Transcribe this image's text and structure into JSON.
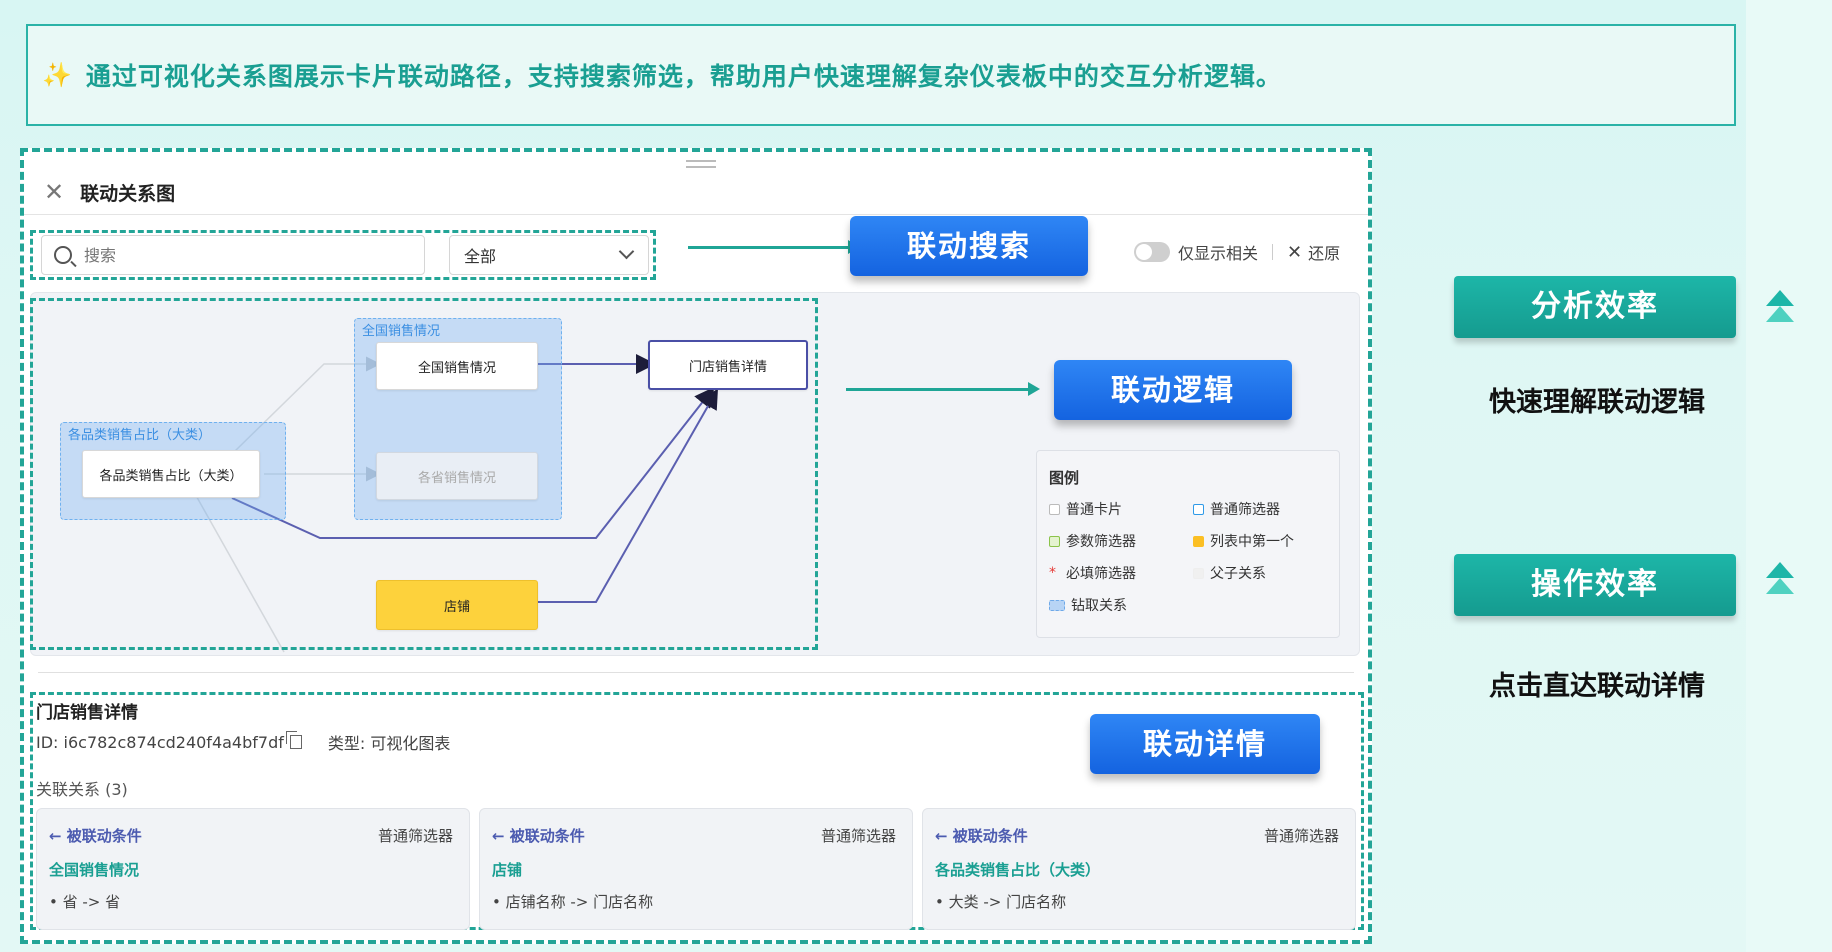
{
  "banner": {
    "icon": "sparkle-icon",
    "text": "通过可视化关系图展示卡片联动路径，支持搜索筛选，帮助用户快速理解复杂仪表板中的交互分析逻辑。"
  },
  "panel": {
    "title": "联动关系图",
    "search_placeholder": "搜索",
    "filter_value": "全部",
    "toggle_label": "仅显示相关",
    "restore_label": "还原"
  },
  "callouts": {
    "search": "联动搜索",
    "logic": "联动逻辑",
    "detail": "联动详情"
  },
  "graph": {
    "groups": [
      {
        "label": "全国销售情况"
      },
      {
        "label": "各品类销售占比（大类）"
      }
    ],
    "nodes": {
      "national_sales": "全国销售情况",
      "store_detail": "门店销售详情",
      "category_share": "各品类销售占比（大类）",
      "province_sales": "各省销售情况",
      "store": "店铺"
    }
  },
  "legend": {
    "title": "图例",
    "items": [
      {
        "label": "普通卡片",
        "color": "#ffffff"
      },
      {
        "label": "普通筛选器",
        "color": "#2f9ae8"
      },
      {
        "label": "参数筛选器",
        "color": "#8bc34a"
      },
      {
        "label": "列表中第一个",
        "color": "#fbbf24"
      },
      {
        "label": "必填筛选器",
        "color": "#e53935",
        "marker": "*"
      },
      {
        "label": "父子关系",
        "color": "#f0f0f0"
      },
      {
        "label": "钻取关系",
        "color": "#b7d4f5"
      }
    ]
  },
  "detail": {
    "title": "门店销售详情",
    "id_text": "ID: i6c782c874cd240f4a4bf7df",
    "type_text": "类型: 可视化图表",
    "relation_count": "关联关系 (3)",
    "relations": [
      {
        "direction": "← 被联动条件",
        "type": "普通筛选器",
        "name": "全国销售情况",
        "mapping": "• 省 -> 省"
      },
      {
        "direction": "← 被联动条件",
        "type": "普通筛选器",
        "name": "店铺",
        "mapping": "• 店铺名称 -> 门店名称"
      },
      {
        "direction": "← 被联动条件",
        "type": "普通筛选器",
        "name": "各品类销售占比（大类）",
        "mapping": "• 大类 -> 门店名称"
      }
    ]
  },
  "side": {
    "badges": [
      {
        "label": "分析效率",
        "desc": "快速理解联动逻辑"
      },
      {
        "label": "操作效率",
        "desc": "点击直达联动详情"
      }
    ]
  },
  "colors": {
    "accent": "#23a597",
    "callout_blue": "#1f74ea",
    "edge": "#5b5fb0"
  }
}
